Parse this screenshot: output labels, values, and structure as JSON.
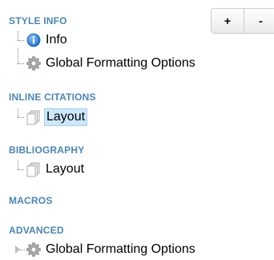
{
  "style_info": {
    "heading": "STYLE INFO",
    "items": [
      {
        "label": "Info",
        "icon": "info-icon"
      },
      {
        "label": "Global Formatting Options",
        "icon": "gear-icon"
      }
    ]
  },
  "toolbar": {
    "add_label": "+",
    "remove_label": "-"
  },
  "inline_citations": {
    "heading": "INLINE CITATIONS",
    "items": [
      {
        "label": "Layout",
        "icon": "layout-pages-icon",
        "selected": true
      }
    ]
  },
  "bibliography": {
    "heading": "BIBLIOGRAPHY",
    "items": [
      {
        "label": "Layout",
        "icon": "layout-pages-icon"
      }
    ]
  },
  "macros": {
    "heading": "MACROS"
  },
  "advanced": {
    "heading": "ADVANCED",
    "items": [
      {
        "label": "Global Formatting Options",
        "icon": "gear-icon",
        "expandable": true
      }
    ]
  },
  "colors": {
    "heading": "#4a86b8",
    "selection_bg": "#cde8fa",
    "info_icon": "#2f7fd3"
  }
}
